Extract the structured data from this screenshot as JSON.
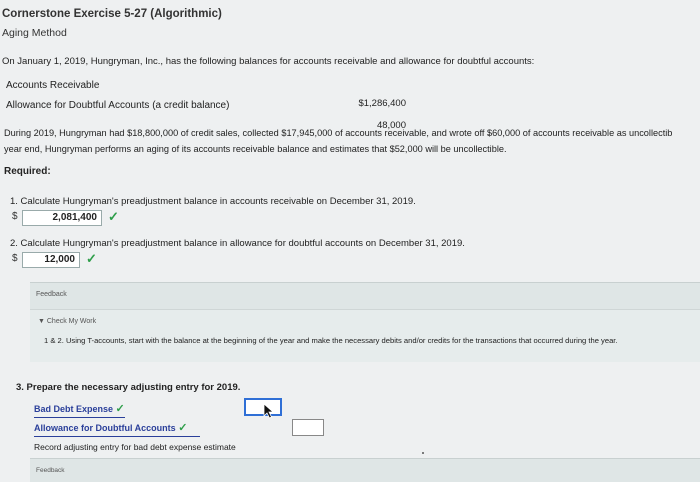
{
  "header": {
    "title": "Cornerstone Exercise 5-27 (Algorithmic)",
    "subtitle": "Aging Method"
  },
  "problem": {
    "intro": "On January 1, 2019, Hungryman, Inc., has the following balances for accounts receivable and allowance for doubtful accounts:",
    "balances": [
      {
        "label": "Accounts Receivable",
        "value": "$1,286,400"
      },
      {
        "label": "Allowance for Doubtful Accounts (a credit balance)",
        "value": "48,000"
      }
    ],
    "during_line1": "During 2019, Hungryman had $18,800,000 of credit sales, collected $17,945,000 of accounts receivable, and wrote off $60,000 of accounts receivable as uncollectib",
    "during_line2": "year end, Hungryman performs an aging of its accounts receivable balance and estimates that $52,000 will be uncollectible.",
    "required_label": "Required:"
  },
  "questions": {
    "q1": {
      "text": "1.  Calculate Hungryman's preadjustment balance in accounts receivable on December 31, 2019.",
      "currency": "$",
      "answer": "2,081,400",
      "status_icon": "check-icon"
    },
    "q2": {
      "text": "2.  Calculate Hungryman's preadjustment balance in allowance for doubtful accounts on December 31, 2019.",
      "currency": "$",
      "answer": "12,000",
      "status_icon": "check-icon"
    },
    "q3": {
      "text": "3.  Prepare the necessary adjusting entry for 2019.",
      "accounts": [
        "Bad Debt Expense",
        "Allowance for Doubtful Accounts"
      ],
      "record_text": "Record adjusting entry for bad debt expense estimate"
    }
  },
  "feedback": {
    "label": "Feedback",
    "check_my_work": "▼ Check My Work",
    "hint": "1 & 2. Using T-accounts, start with the balance at the beginning of the year and make the necessary debits and/or credits for the transactions that occurred during the year."
  },
  "feedback2": {
    "label": "Feedback"
  },
  "colors": {
    "check": "#2e9e4a",
    "link": "#2a3f9a",
    "active_box_border": "#2f6fd6",
    "panel": "#dfe6e6"
  }
}
